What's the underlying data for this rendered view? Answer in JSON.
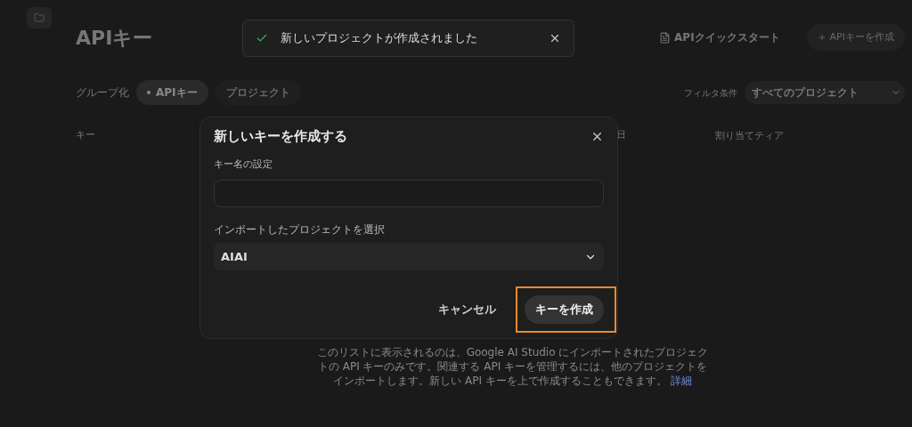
{
  "page": {
    "title": "APIキー",
    "quickstart_link": "APIクイックスタート",
    "create_button": "APIキーを作成",
    "group_label": "グループ化",
    "group_chips": [
      {
        "label": "APIキー",
        "selected": true
      },
      {
        "label": "プロジェクト",
        "selected": false
      }
    ],
    "filter_label": "フィルタ条件",
    "filter_value": "すべてのプロジェクト",
    "columns": [
      "キー",
      "日",
      "割り当てティア"
    ],
    "footer": "このリストに表示されるのは、Google AI Studio にインポートされたプロジェクトの API キーのみです。関連する API キーを管理するには、他のプロジェクトをインポートします。新しい API キーを上で作成することもできます。",
    "footer_link": "詳細"
  },
  "toast": {
    "message": "新しいプロジェクトが作成されました"
  },
  "dialog": {
    "title": "新しいキーを作成する",
    "name_label": "キー名の設定",
    "project_label": "インポートしたプロジェクトを選択",
    "project_value": "AIAI",
    "cancel": "キャンセル",
    "submit": "キーを作成",
    "submit_highlighted": true
  }
}
